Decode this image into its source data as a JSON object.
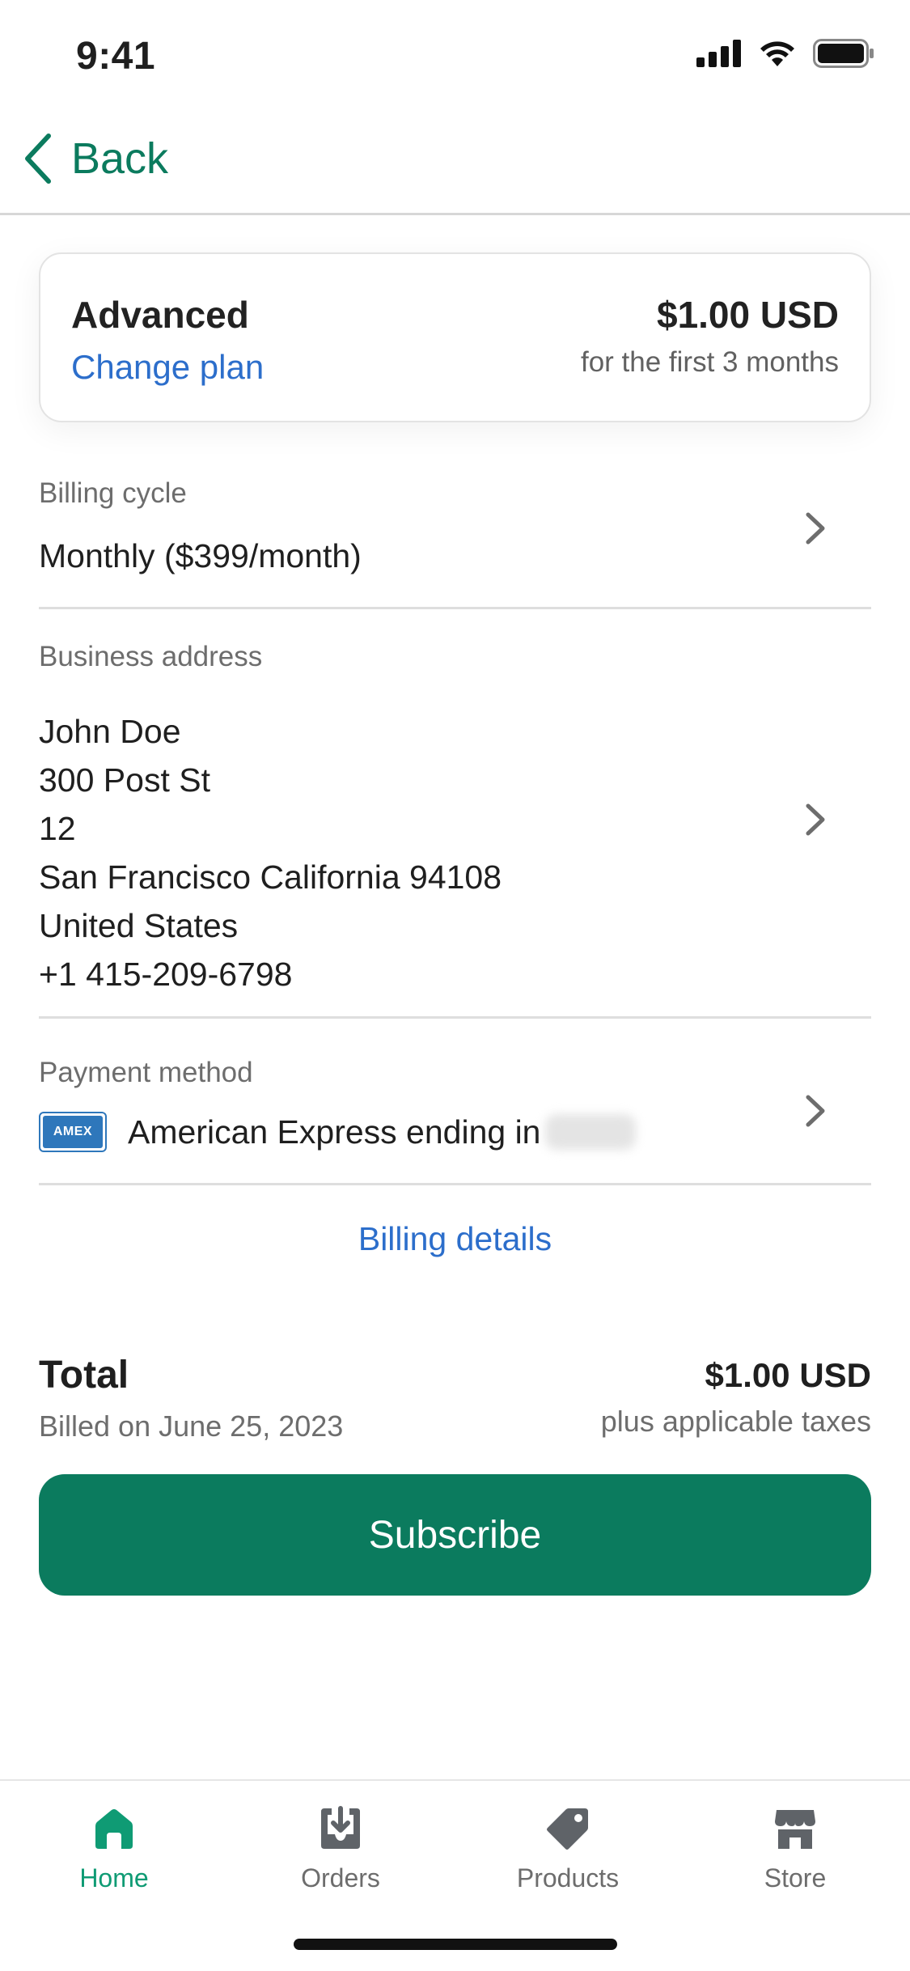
{
  "status_bar": {
    "time": "9:41"
  },
  "nav": {
    "back_label": "Back"
  },
  "plan": {
    "name": "Advanced",
    "change_label": "Change plan",
    "price": "$1.00 USD",
    "price_note": "for the first 3 months"
  },
  "billing_cycle": {
    "label": "Billing cycle",
    "value": "Monthly ($399/month)"
  },
  "business_address": {
    "label": "Business address",
    "lines": [
      "John Doe",
      "300 Post St",
      "12",
      "San Francisco California 94108",
      "United States",
      "+1 415-209-6798"
    ]
  },
  "payment_method": {
    "label": "Payment method",
    "card_brand_badge": "AMEX",
    "text": "American Express ending in"
  },
  "billing_details_label": "Billing details",
  "total": {
    "label": "Total",
    "billed_on": "Billed on June 25, 2023",
    "amount": "$1.00 USD",
    "taxes_note": "plus applicable taxes"
  },
  "subscribe_label": "Subscribe",
  "tabs": [
    {
      "label": "Home",
      "icon": "home-icon",
      "active": true
    },
    {
      "label": "Orders",
      "icon": "orders-icon",
      "active": false
    },
    {
      "label": "Products",
      "icon": "products-tag-icon",
      "active": false
    },
    {
      "label": "Store",
      "icon": "store-icon",
      "active": false
    }
  ],
  "colors": {
    "brand_green": "#0b7b5e",
    "link_blue": "#2c6ecb",
    "tab_active": "#0f9b74",
    "tab_inactive": "#6d6d6d"
  }
}
